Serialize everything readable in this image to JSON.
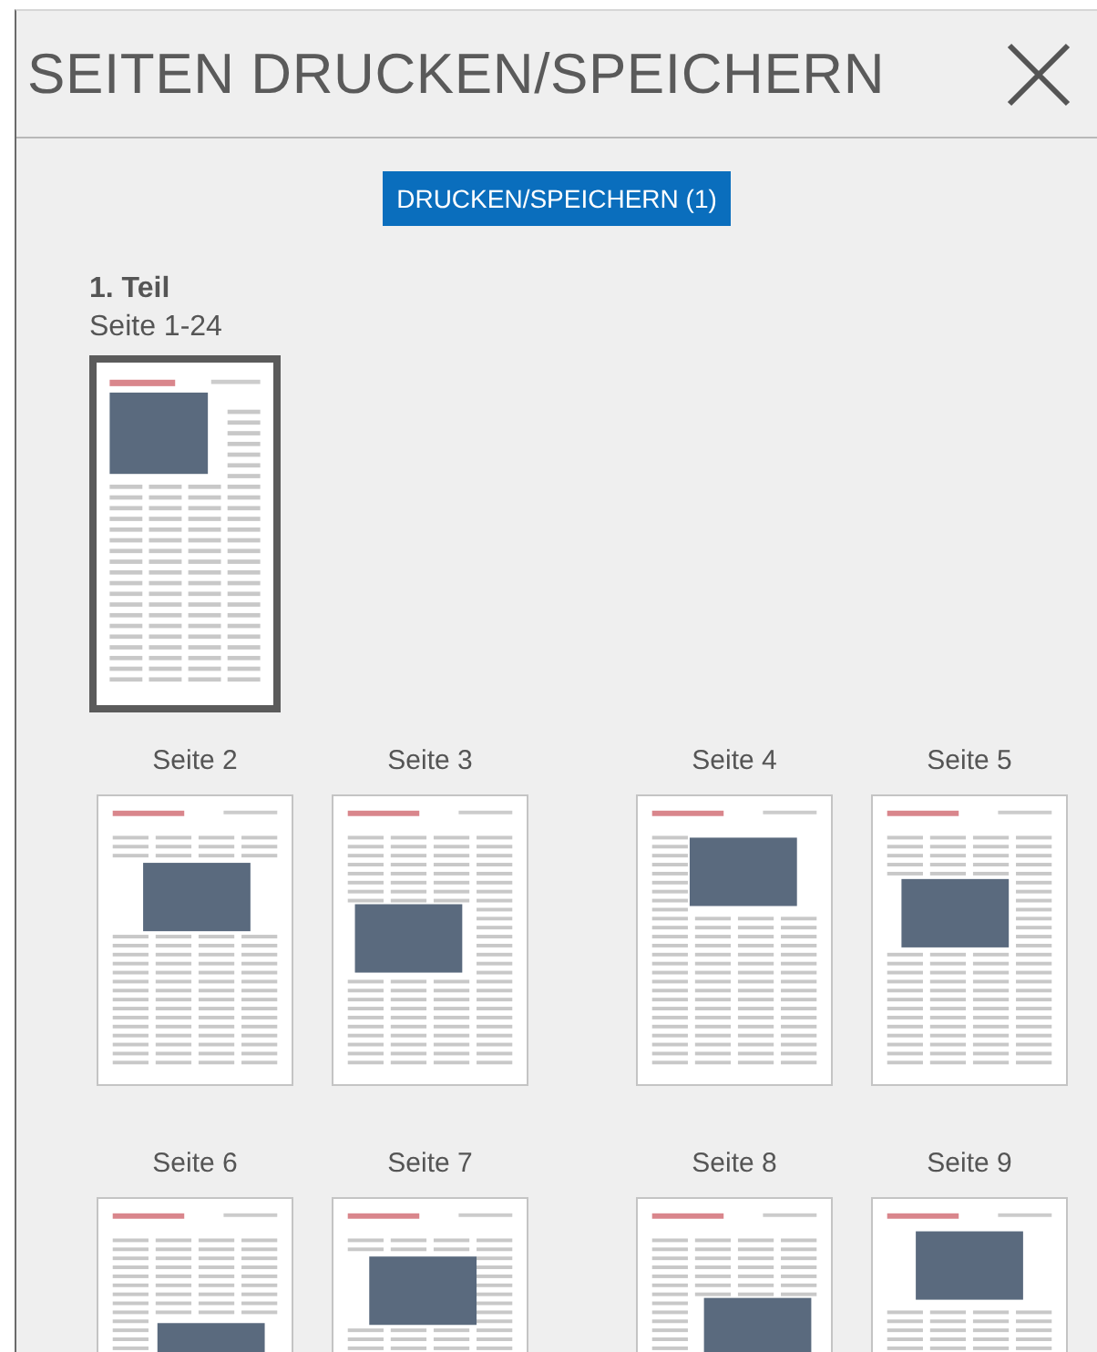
{
  "header": {
    "title": "SEITEN DRUCKEN/SPEICHERN"
  },
  "print_button": {
    "label": "DRUCKEN/SPEICHERN (1)"
  },
  "section": {
    "title": "1. Teil",
    "subtitle": "Seite 1-24",
    "cover": {
      "selected": true
    },
    "pages": [
      {
        "label": "Seite 2",
        "selected": false
      },
      {
        "label": "Seite 3",
        "selected": false
      },
      {
        "label": "Seite 4",
        "selected": false
      },
      {
        "label": "Seite 5",
        "selected": false
      },
      {
        "label": "Seite 6",
        "selected": false
      },
      {
        "label": "Seite 7",
        "selected": false
      },
      {
        "label": "Seite 8",
        "selected": false
      },
      {
        "label": "Seite 9",
        "selected": false
      }
    ]
  }
}
